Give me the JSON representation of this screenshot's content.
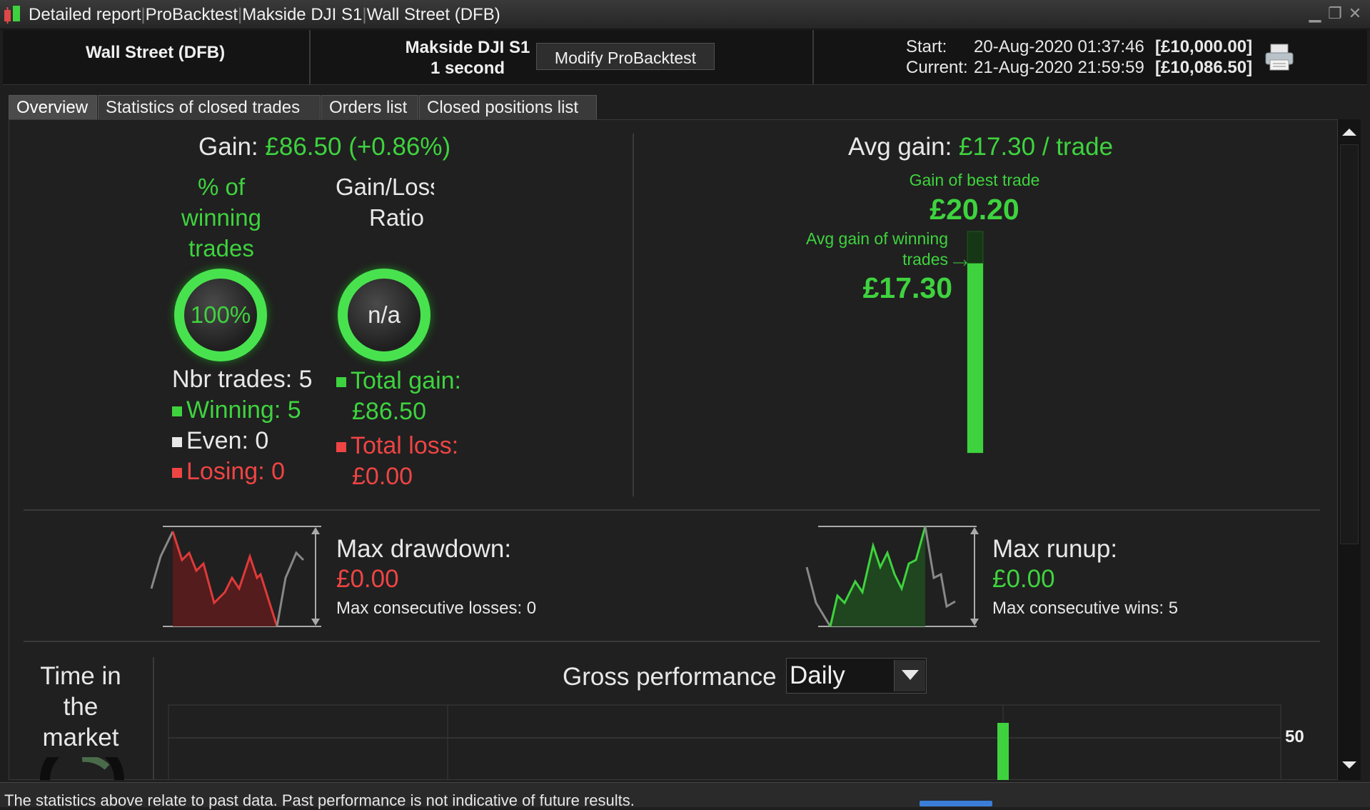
{
  "window": {
    "title": "Detailed report ProBacktest Makside DJI S1 Wall Street (DFB)",
    "title_parts": [
      "Detailed report",
      "ProBacktest",
      "Makside DJI S1",
      "Wall Street (DFB)"
    ],
    "controls": [
      "minimize-icon",
      "restore-icon",
      "close-icon"
    ]
  },
  "header": {
    "instrument": "Wall Street (DFB)",
    "system_name": "Makside DJI S1",
    "timeframe": "1 second",
    "modify_button": "Modify ProBacktest",
    "start_label": "Start:",
    "current_label": "Current:",
    "start_date": "20-Aug-2020 01:37:46",
    "current_date": "21-Aug-2020 21:59:59",
    "start_capital": "[£10,000.00]",
    "current_capital": "[£10,086.50]",
    "print_icon": "printer-icon"
  },
  "tabs": [
    {
      "label": "Overview",
      "active": true
    },
    {
      "label": "Statistics of closed trades",
      "active": false
    },
    {
      "label": "Orders list",
      "active": false
    },
    {
      "label": "Closed positions list",
      "active": false
    }
  ],
  "overview": {
    "gain_label": "Gain:",
    "gain_value": "£86.50",
    "gain_pct": "(+0.86%)",
    "winning_pct_label": [
      "% of",
      "winning",
      "trades"
    ],
    "winning_pct_value": "100%",
    "winning_pct": 1.0,
    "ratio_label": [
      "Gain/Loss",
      "Ratio"
    ],
    "ratio_value": "n/a",
    "nbr_trades": "Nbr trades: 5",
    "winning": "Winning: 5",
    "even": "Even: 0",
    "losing": "Losing: 0",
    "total_gain_label": "Total gain:",
    "total_gain_value": "£86.50",
    "total_loss_label": "Total loss:",
    "total_loss_value": "£0.00",
    "avg_gain_label": "Avg gain:",
    "avg_gain_value": "£17.30 / trade",
    "best_trade_label": "Gain of best trade",
    "best_trade_value": "£20.20",
    "avg_winning_label": [
      "Avg gain of winning",
      "trades"
    ],
    "avg_winning_value": "£17.30",
    "avg_winning_fraction": 0.856,
    "max_drawdown_label": "Max drawdown:",
    "max_drawdown_value": "£0.00",
    "max_consec_losses": "Max consecutive losses: 0",
    "max_runup_label": "Max runup:",
    "max_runup_value": "£0.00",
    "max_consec_wins": "Max consecutive wins: 5",
    "time_in_market_label": [
      "Time in",
      "the",
      "market"
    ],
    "gross_perf_label": "Gross performance",
    "period_option": "Daily",
    "axis_tick": "50"
  },
  "colors": {
    "green": "#3ed33e",
    "red": "#ef4444",
    "bright_green": "#49e24f"
  },
  "footer": {
    "disclaimer": "The statistics above relate to past data. Past performance is not indicative of future results."
  }
}
